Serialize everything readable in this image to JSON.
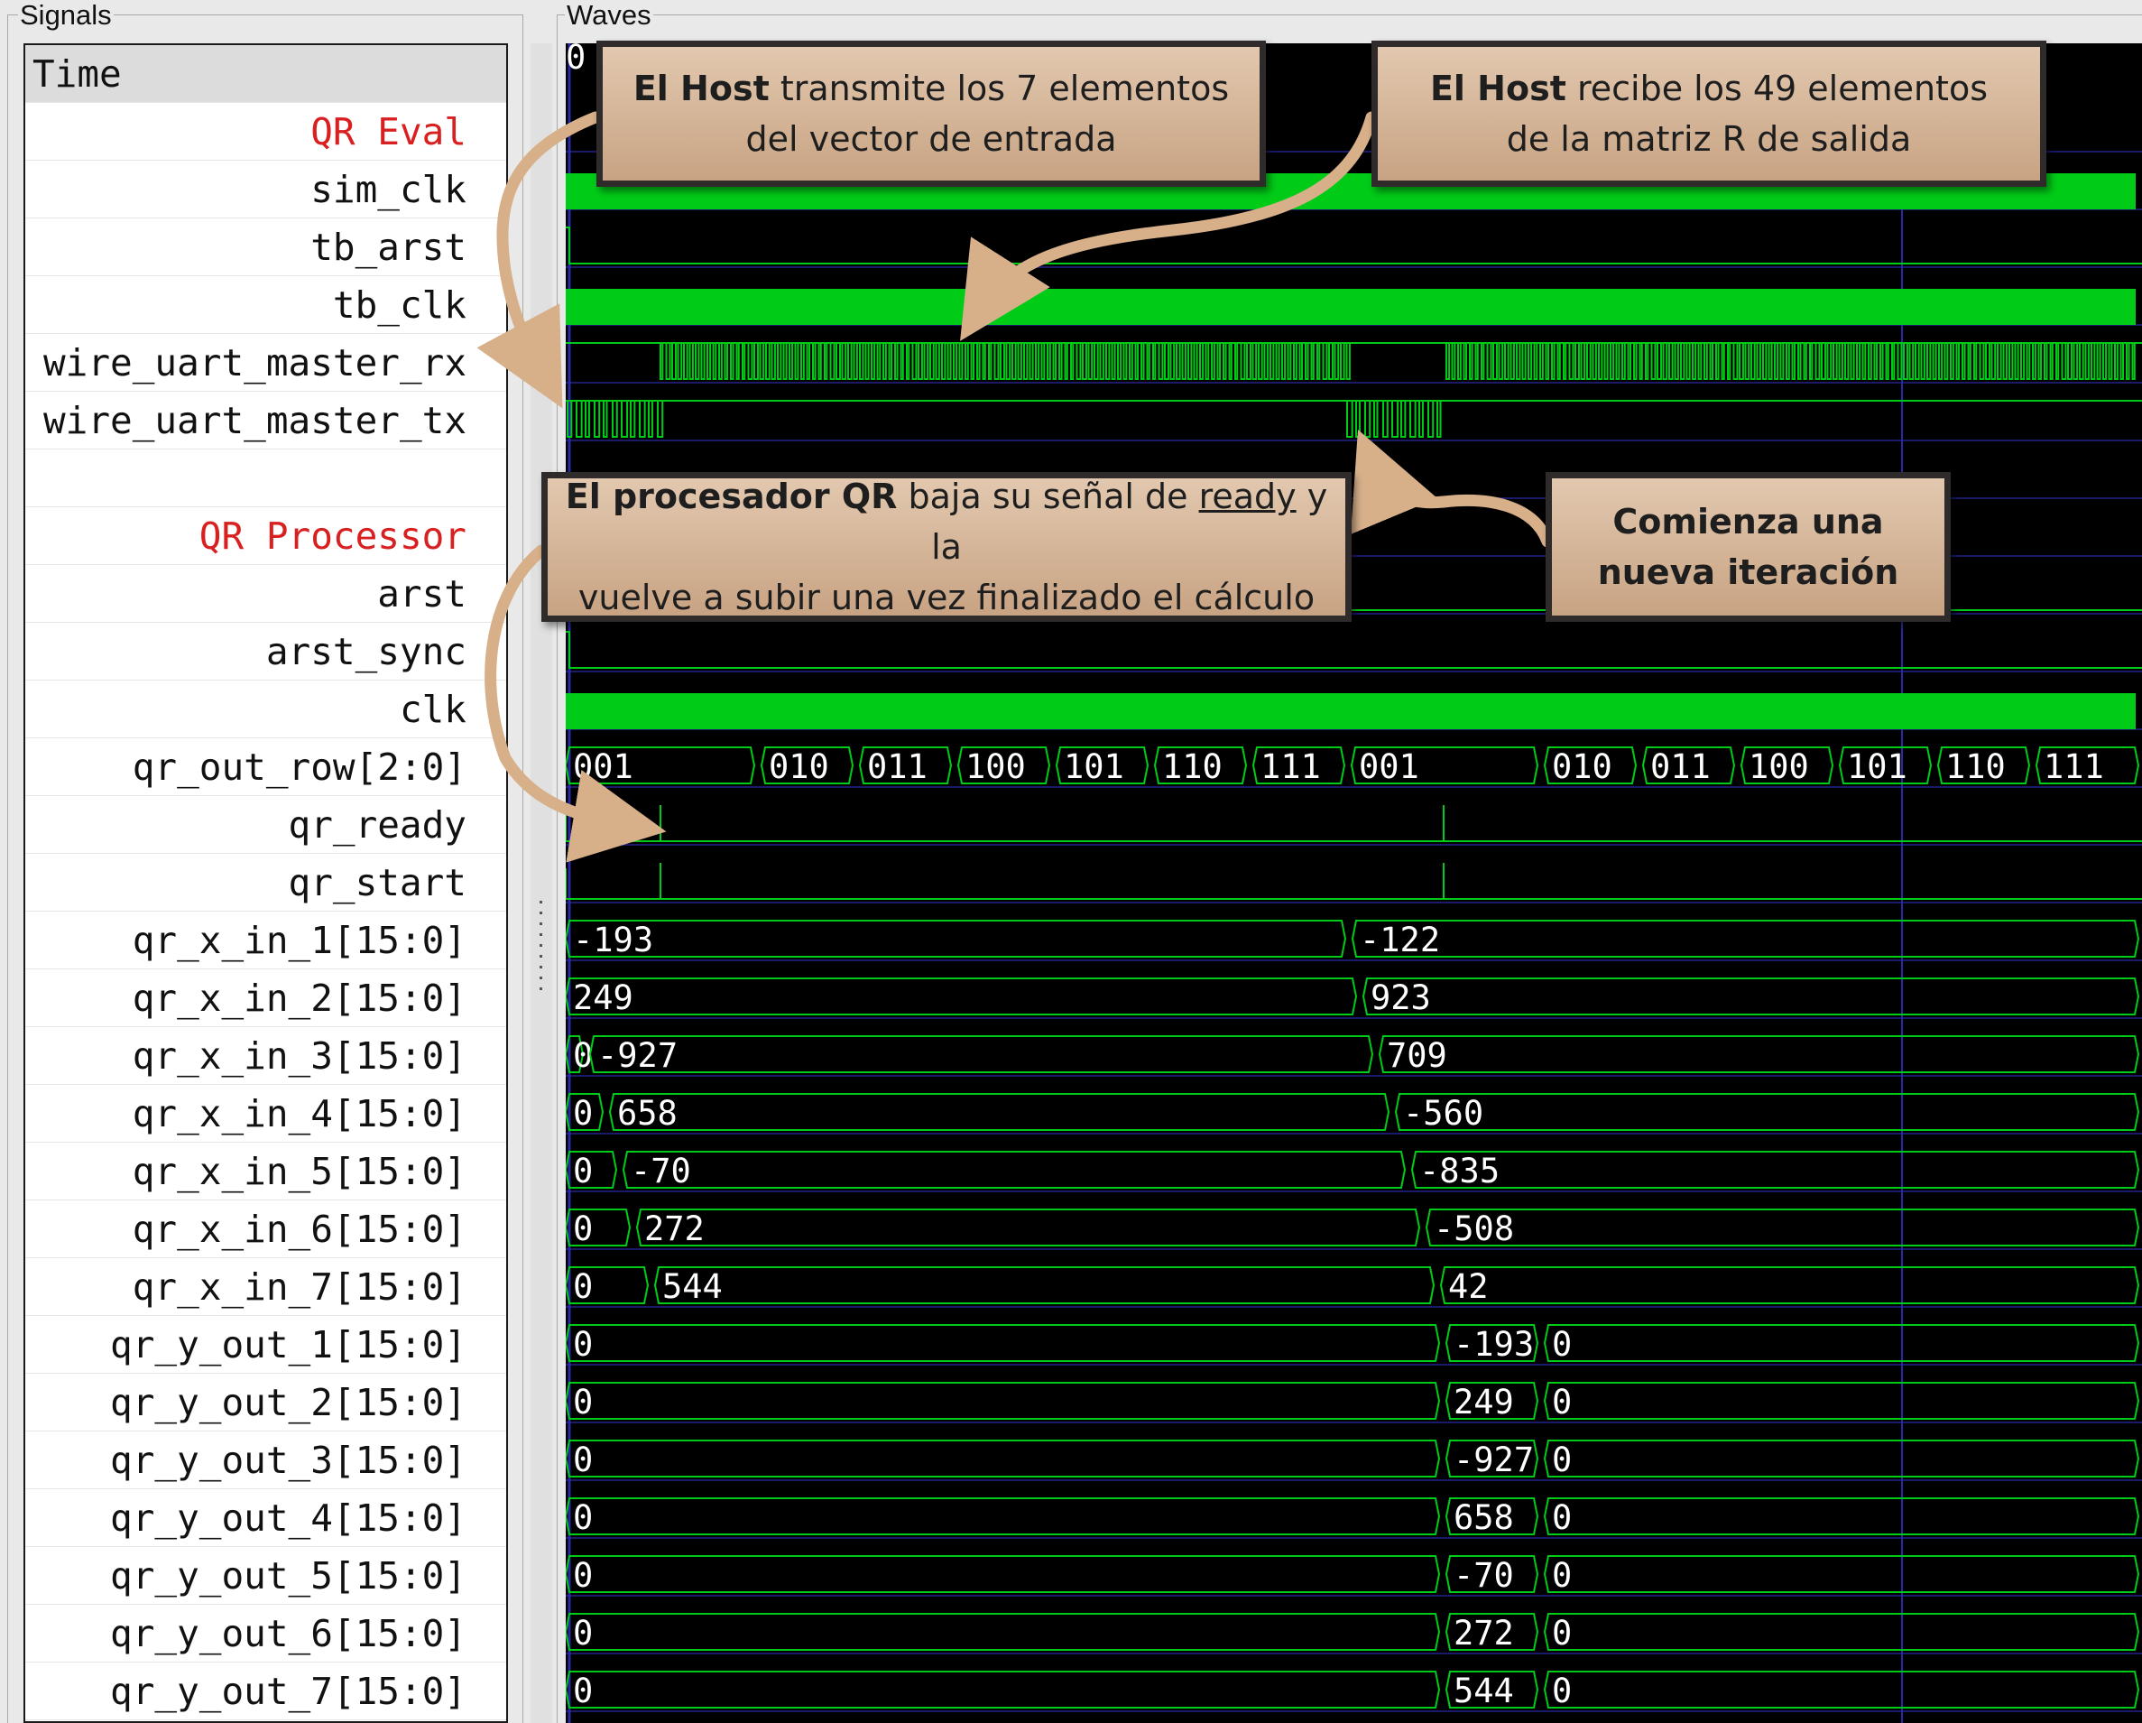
{
  "panels": {
    "signals_title": "Signals",
    "waves_title": "Waves"
  },
  "signals": [
    {
      "label": "Time",
      "kind": "time"
    },
    {
      "label": "QR Eval",
      "kind": "group"
    },
    {
      "label": "sim_clk",
      "kind": "sig"
    },
    {
      "label": "tb_arst",
      "kind": "sig"
    },
    {
      "label": "tb_clk",
      "kind": "sig"
    },
    {
      "label": "wire_uart_master_rx",
      "kind": "sig"
    },
    {
      "label": "wire_uart_master_tx",
      "kind": "sig"
    },
    {
      "label": "",
      "kind": "blank"
    },
    {
      "label": "QR Processor",
      "kind": "group"
    },
    {
      "label": "arst",
      "kind": "sig"
    },
    {
      "label": "arst_sync",
      "kind": "sig"
    },
    {
      "label": "clk",
      "kind": "sig"
    },
    {
      "label": "qr_out_row[2:0]",
      "kind": "sig"
    },
    {
      "label": "qr_ready",
      "kind": "sig"
    },
    {
      "label": "qr_start",
      "kind": "sig"
    },
    {
      "label": "qr_x_in_1[15:0]",
      "kind": "sig"
    },
    {
      "label": "qr_x_in_2[15:0]",
      "kind": "sig"
    },
    {
      "label": "qr_x_in_3[15:0]",
      "kind": "sig"
    },
    {
      "label": "qr_x_in_4[15:0]",
      "kind": "sig"
    },
    {
      "label": "qr_x_in_5[15:0]",
      "kind": "sig"
    },
    {
      "label": "qr_x_in_6[15:0]",
      "kind": "sig"
    },
    {
      "label": "qr_x_in_7[15:0]",
      "kind": "sig"
    },
    {
      "label": "qr_y_out_1[15:0]",
      "kind": "sig"
    },
    {
      "label": "qr_y_out_2[15:0]",
      "kind": "sig"
    },
    {
      "label": "qr_y_out_3[15:0]",
      "kind": "sig"
    },
    {
      "label": "qr_y_out_4[15:0]",
      "kind": "sig"
    },
    {
      "label": "qr_y_out_5[15:0]",
      "kind": "sig"
    },
    {
      "label": "qr_y_out_6[15:0]",
      "kind": "sig"
    },
    {
      "label": "qr_y_out_7[15:0]",
      "kind": "sig"
    }
  ],
  "waves": {
    "time_start_label": "0",
    "qr_out_row": [
      "001",
      "010",
      "011",
      "100",
      "101",
      "110",
      "111",
      "001",
      "010",
      "011",
      "100",
      "101",
      "110",
      "111"
    ],
    "qr_x_in": [
      [
        "-193",
        "-122"
      ],
      [
        "249",
        "923"
      ],
      [
        "0",
        "-927",
        "709"
      ],
      [
        "0",
        "658",
        "-560"
      ],
      [
        "0",
        "-70",
        "-835"
      ],
      [
        "0",
        "272",
        "-508"
      ],
      [
        "0",
        "544",
        "42"
      ]
    ],
    "qr_y_out": [
      [
        "0",
        "-193",
        "0"
      ],
      [
        "0",
        "249",
        "0"
      ],
      [
        "0",
        "-927",
        "0"
      ],
      [
        "0",
        "658",
        "0"
      ],
      [
        "0",
        "-70",
        "0"
      ],
      [
        "0",
        "272",
        "0"
      ],
      [
        "0",
        "544",
        "0"
      ]
    ]
  },
  "callouts": {
    "host_tx": {
      "bold": "El Host",
      "rest1": " transmite los 7 elementos",
      "line2": "del vector de entrada"
    },
    "host_rx": {
      "bold": "El Host",
      "rest1": " recibe los 49 elementos",
      "line2": "de la matriz R de salida"
    },
    "qr_ready": {
      "bold": "El procesador QR",
      "rest1a": " baja su señal de ",
      "underline": "ready",
      "rest1b": " y la",
      "line2": "vuelve a subir una vez finalizado el cálculo"
    },
    "new_iter": {
      "line1": "Comienza una",
      "line2": "nueva iteración"
    }
  },
  "colors": {
    "wave_green": "#00cc17",
    "bus_green": "#22dd22",
    "grid_blue": "#2a2aa8",
    "callout_fill": "#d5b597",
    "arrow": "#d7b08a",
    "group_red": "#d92020"
  }
}
